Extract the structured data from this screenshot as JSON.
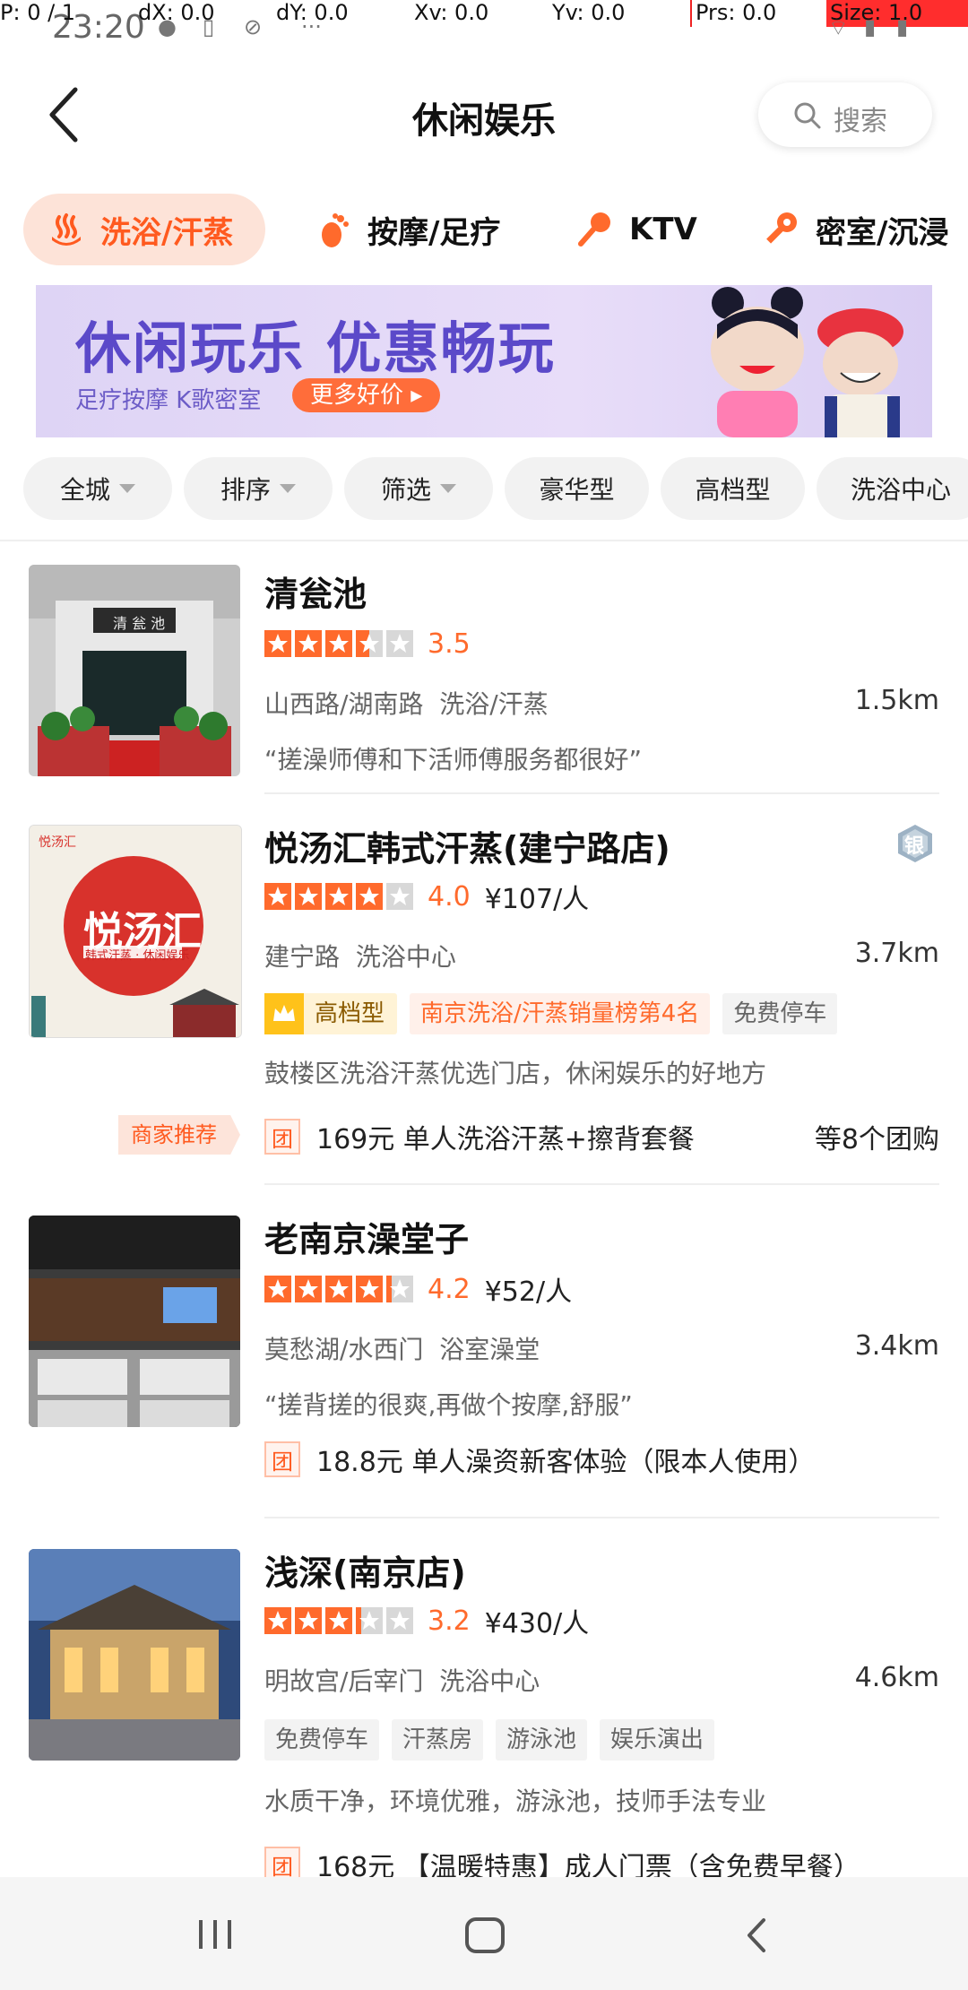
{
  "status_bar": {
    "time": "23:20",
    "debug": {
      "p": "P: 0 / 1",
      "dx": "dX: 0.0",
      "dy": "dY: 0.0",
      "xv": "Xv: 0.0",
      "yv": "Yv: 0.0",
      "prs": "Prs: 0.0",
      "size": "Size: 1.0"
    }
  },
  "header": {
    "title": "休闲娱乐",
    "search_label": "搜索"
  },
  "categories": [
    {
      "label": "洗浴/汗蒸",
      "icon": "hot-spring-icon",
      "active": true
    },
    {
      "label": "按摩/足疗",
      "icon": "footprint-icon",
      "active": false
    },
    {
      "label": "KTV",
      "icon": "microphone-icon",
      "active": false
    },
    {
      "label": "密室/沉浸",
      "icon": "key-icon",
      "active": false
    }
  ],
  "banner": {
    "headline": "休闲玩乐 优惠畅玩",
    "subtitle": "足疗按摩 K歌密室",
    "cta": "更多好价 ▸"
  },
  "filters": [
    {
      "label": "全城",
      "dropdown": true
    },
    {
      "label": "排序",
      "dropdown": true
    },
    {
      "label": "筛选",
      "dropdown": true
    },
    {
      "label": "豪华型",
      "dropdown": false
    },
    {
      "label": "高档型",
      "dropdown": false
    },
    {
      "label": "洗浴中心",
      "dropdown": false
    }
  ],
  "listings": [
    {
      "name": "清瓮池",
      "rating": 3.5,
      "score": "3.5",
      "price": "",
      "area": "山西路/湖南路",
      "category": "洗浴/汗蒸",
      "distance": "1.5km",
      "quote": "“搓澡师傅和下活师傅服务都很好”",
      "thumb_text": "清 瓮 池"
    },
    {
      "name": "悦汤汇韩式汗蒸(建宁路店)",
      "rating": 4.0,
      "score": "4.0",
      "price": "¥107/人",
      "area": "建宁路",
      "category": "洗浴中心",
      "distance": "3.7km",
      "badge_silver": "银",
      "tags": {
        "level": "高档型",
        "rank": "南京洗浴/汗蒸销量榜第4名",
        "parking": "免费停车"
      },
      "desc": "鼓楼区洗浴汗蒸优选门店，休闲娱乐的好地方",
      "merchant": "商家推荐",
      "deal": {
        "tag": "团",
        "text": "169元 单人洗浴汗蒸+擦背套餐",
        "more": "等8个团购"
      },
      "thumb_text": {
        "brand": "悦汤汇",
        "sub": "韩式汗蒸 · 休闲娱乐",
        "logo": "悦汤汇"
      }
    },
    {
      "name": "老南京澡堂子",
      "rating": 4.2,
      "score": "4.2",
      "price": "¥52/人",
      "area": "莫愁湖/水西门",
      "category": "浴室澡堂",
      "distance": "3.4km",
      "quote": "“搓背搓的很爽,再做个按摩,舒服”",
      "deal": {
        "tag": "团",
        "text": "18.8元 单人澡资新客体验（限本人使用）"
      }
    },
    {
      "name": "浅深(南京店)",
      "rating": 3.2,
      "score": "3.2",
      "price": "¥430/人",
      "area": "明故宫/后宰门",
      "category": "洗浴中心",
      "distance": "4.6km",
      "tags": [
        "免费停车",
        "汗蒸房",
        "游泳池",
        "娱乐演出"
      ],
      "desc": "水质干净，环境优雅，游泳池，技师手法专业",
      "deal": {
        "tag": "团",
        "text": "168元 【温暖特惠】成人门票（含免费早餐）"
      }
    }
  ],
  "colors": {
    "accent": "#ff5a1f",
    "star": "#ff6a2c",
    "banner_text": "#5b49c9"
  },
  "nav": {
    "icons": [
      "recent-apps-icon",
      "home-icon",
      "back-icon"
    ]
  }
}
